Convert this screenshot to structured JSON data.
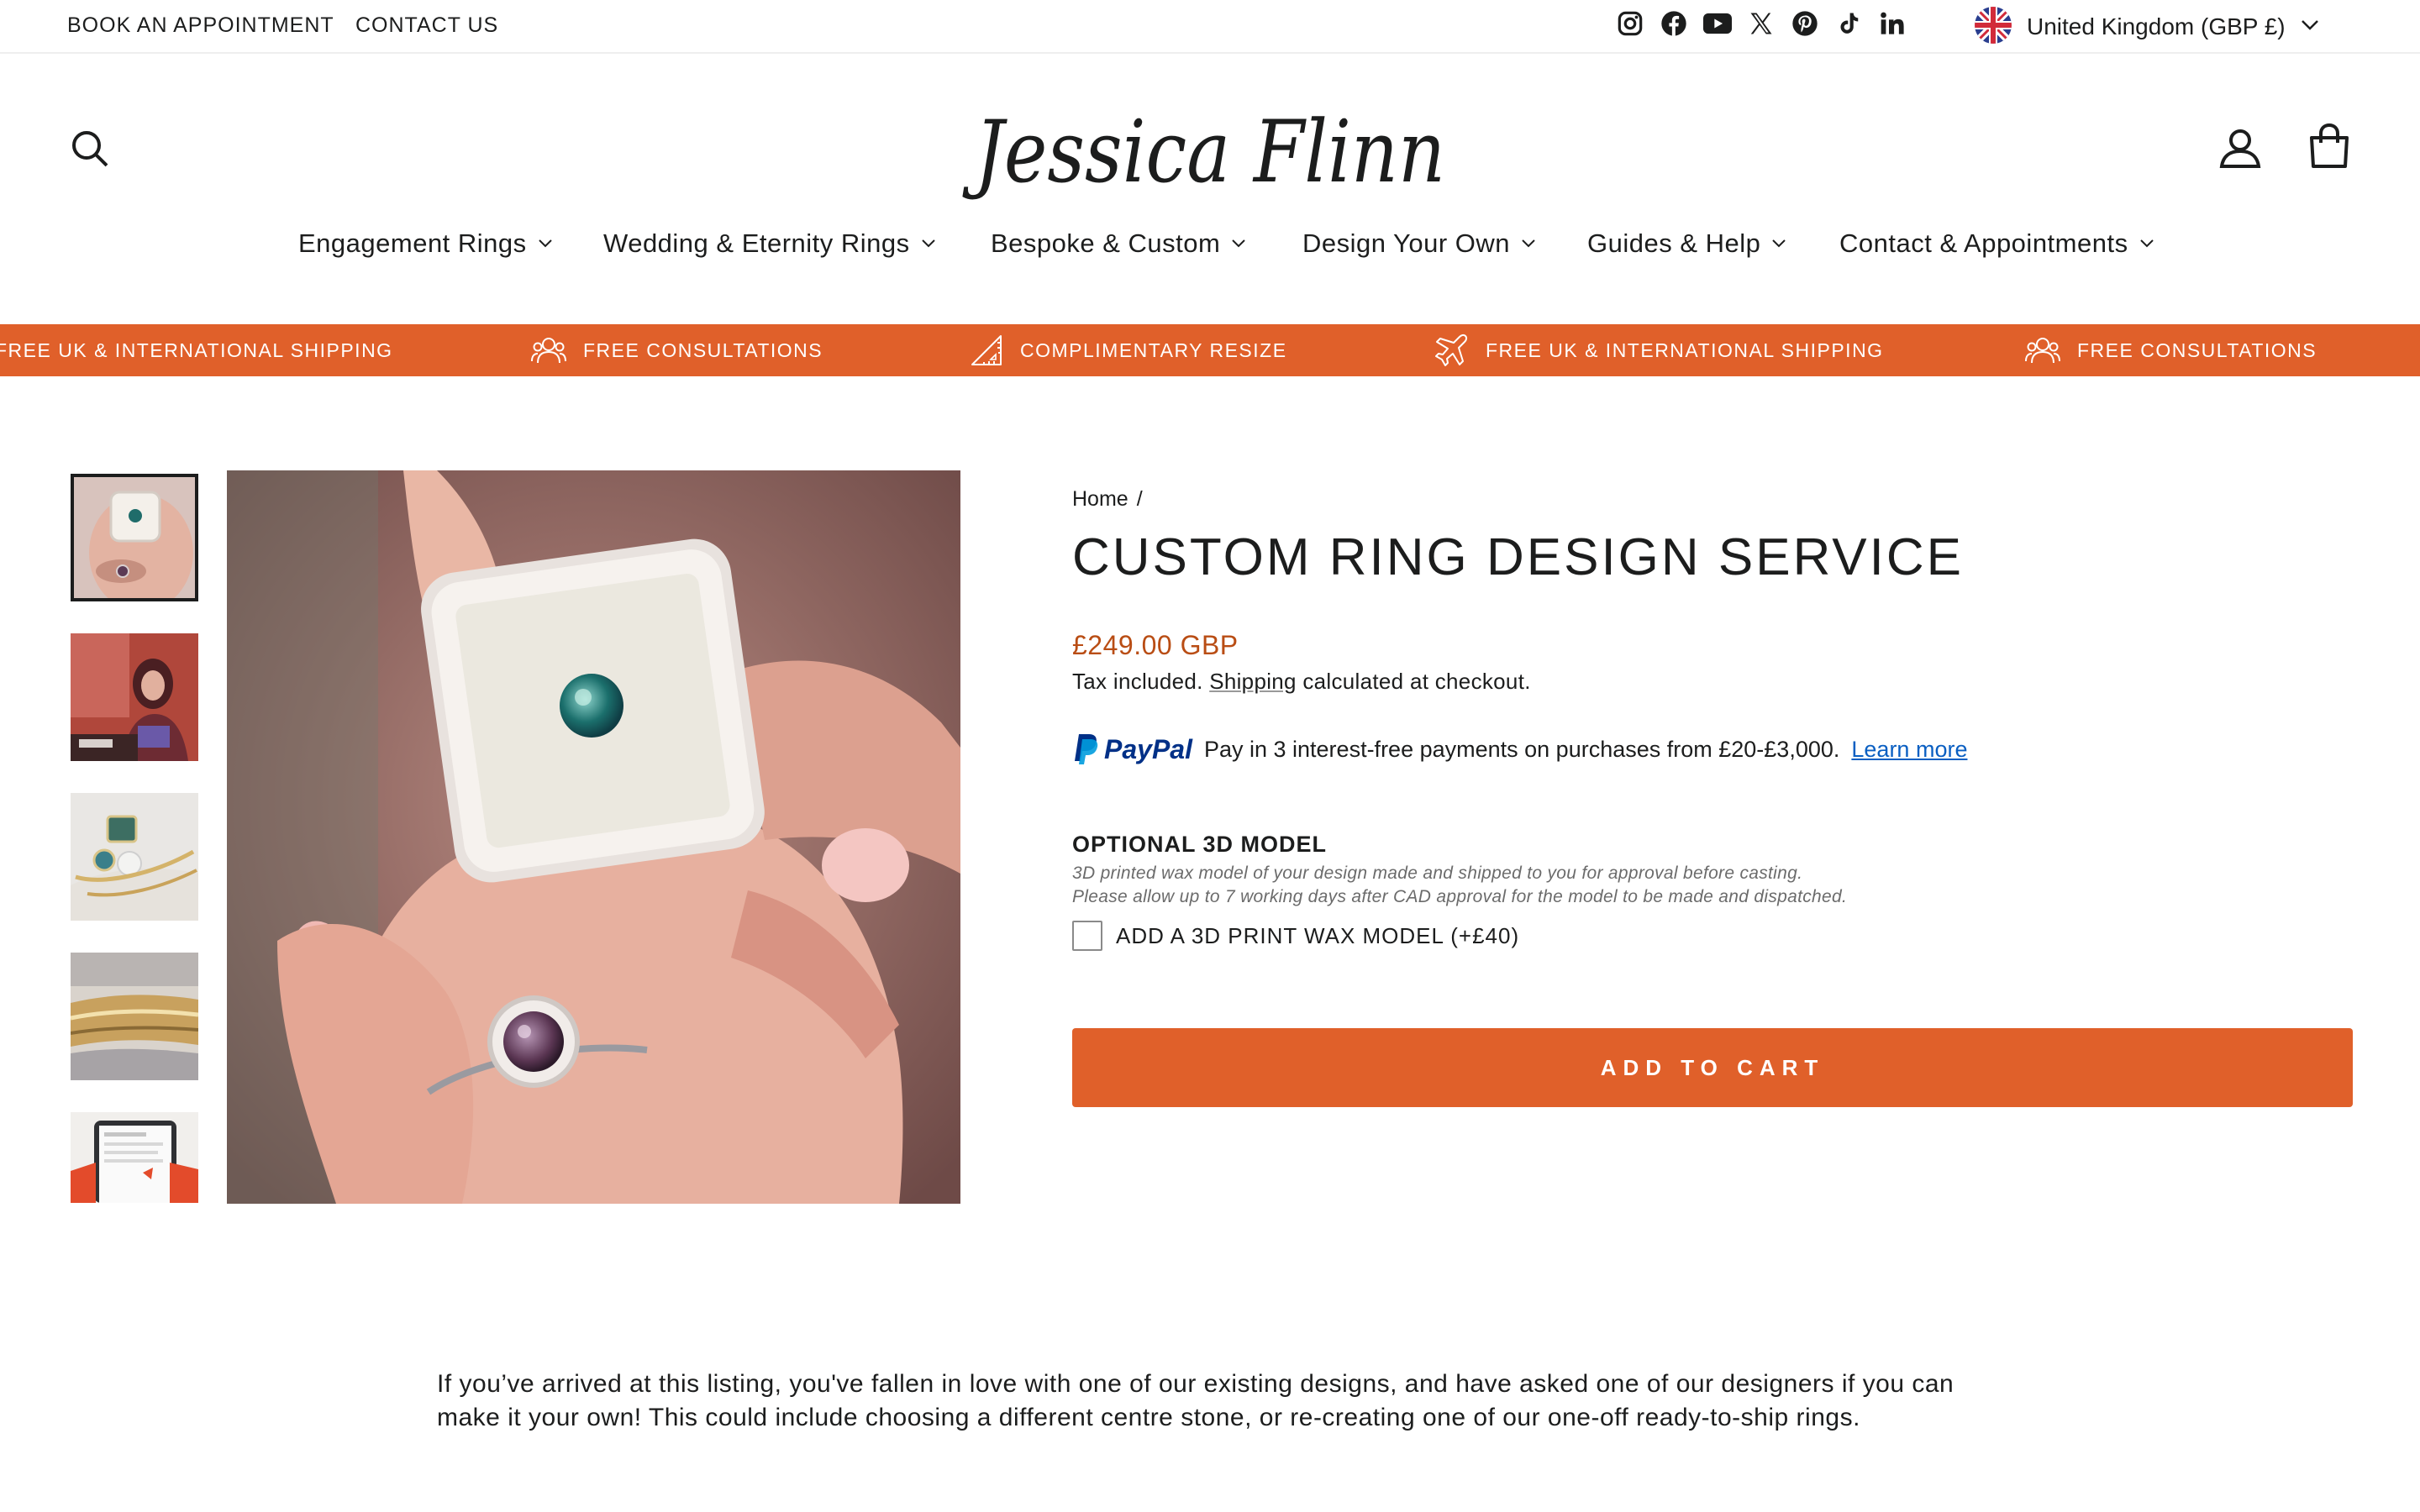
{
  "topbar": {
    "links": [
      "BOOK AN APPOINTMENT",
      "CONTACT US"
    ],
    "social": [
      "instagram-icon",
      "facebook-icon",
      "youtube-icon",
      "x-icon",
      "pinterest-icon",
      "tiktok-icon",
      "linkedin-icon"
    ],
    "country": "United Kingdom (GBP £)"
  },
  "brand": {
    "name": "Jessica Flinn"
  },
  "nav": {
    "items": [
      "Engagement Rings",
      "Wedding & Eternity Rings",
      "Bespoke & Custom",
      "Design Your Own",
      "Guides & Help",
      "Contact & Appointments"
    ]
  },
  "promo": {
    "items": [
      {
        "icon": "plane-icon",
        "text": "FREE UK & INTERNATIONAL SHIPPING"
      },
      {
        "icon": "people-icon",
        "text": "FREE CONSULTATIONS"
      },
      {
        "icon": "ruler-icon",
        "text": "COMPLIMENTARY RESIZE"
      },
      {
        "icon": "plane-icon",
        "text": "FREE UK & INTERNATIONAL SHIPPING"
      },
      {
        "icon": "people-icon",
        "text": "FREE CONSULTATIONS"
      }
    ]
  },
  "product": {
    "breadcrumb": [
      "Home",
      "/"
    ],
    "title": "CUSTOM RING DESIGN SERVICE",
    "price": "£249.00 GBP",
    "tax_prefix": "Tax included.",
    "tax_link": "Shipping",
    "tax_suffix": "calculated at checkout.",
    "paypal": {
      "brand": "PayPal",
      "text": "Pay in 3 interest-free payments on purchases from £20-£3,000.",
      "link": "Learn more"
    },
    "option": {
      "title": "OPTIONAL 3D MODEL",
      "desc1": "3D printed wax model of your design made and shipped to you for approval before casting.",
      "desc2": "Please allow up to 7 working days after CAD approval for the model to be made and dispatched.",
      "checkbox_label": "ADD A 3D PRINT WAX MODEL (+£40)",
      "checked": false
    },
    "add_to_cart": "ADD TO CART"
  },
  "description": "If you’ve arrived at this listing, you've fallen in love with one of our existing designs, and have asked one of our designers if you can make it your own! This could include choosing a different centre stone, or re-creating one of our one-off ready-to-ship rings.",
  "colors": {
    "accent": "#e0602a",
    "price": "#b94d14",
    "text": "#1c1d1d",
    "paypal_dark": "#003087",
    "paypal_light": "#009cde",
    "link": "#0a5fc2"
  }
}
